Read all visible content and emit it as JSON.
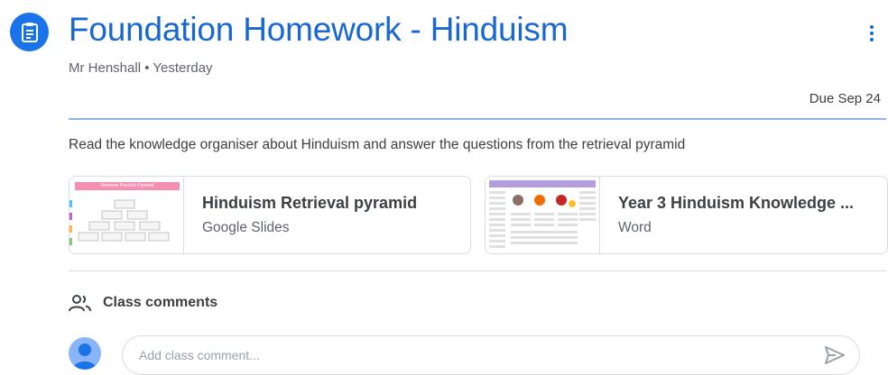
{
  "assignment": {
    "title": "Foundation Homework - Hinduism",
    "author": "Mr Henshall",
    "separator": "•",
    "posted": "Yesterday",
    "due": "Due Sep 24",
    "instructions": "Read the knowledge organiser about Hinduism and answer the questions from the retrieval pyramid",
    "icon": "assignment-icon",
    "accent_color": "#1967d2"
  },
  "attachments": [
    {
      "title": "Hinduism Retrieval pyramid",
      "type": "Google Slides",
      "thumb_label": "Retrieval Practice Pyramid",
      "thumb_banner_color": "#f48fb1"
    },
    {
      "title": "Year 3 Hinduism Knowledge ...",
      "type": "Word"
    }
  ],
  "comments": {
    "heading": "Class comments",
    "placeholder": "Add class comment...",
    "icon": "people-icon",
    "send_icon": "send-icon"
  }
}
